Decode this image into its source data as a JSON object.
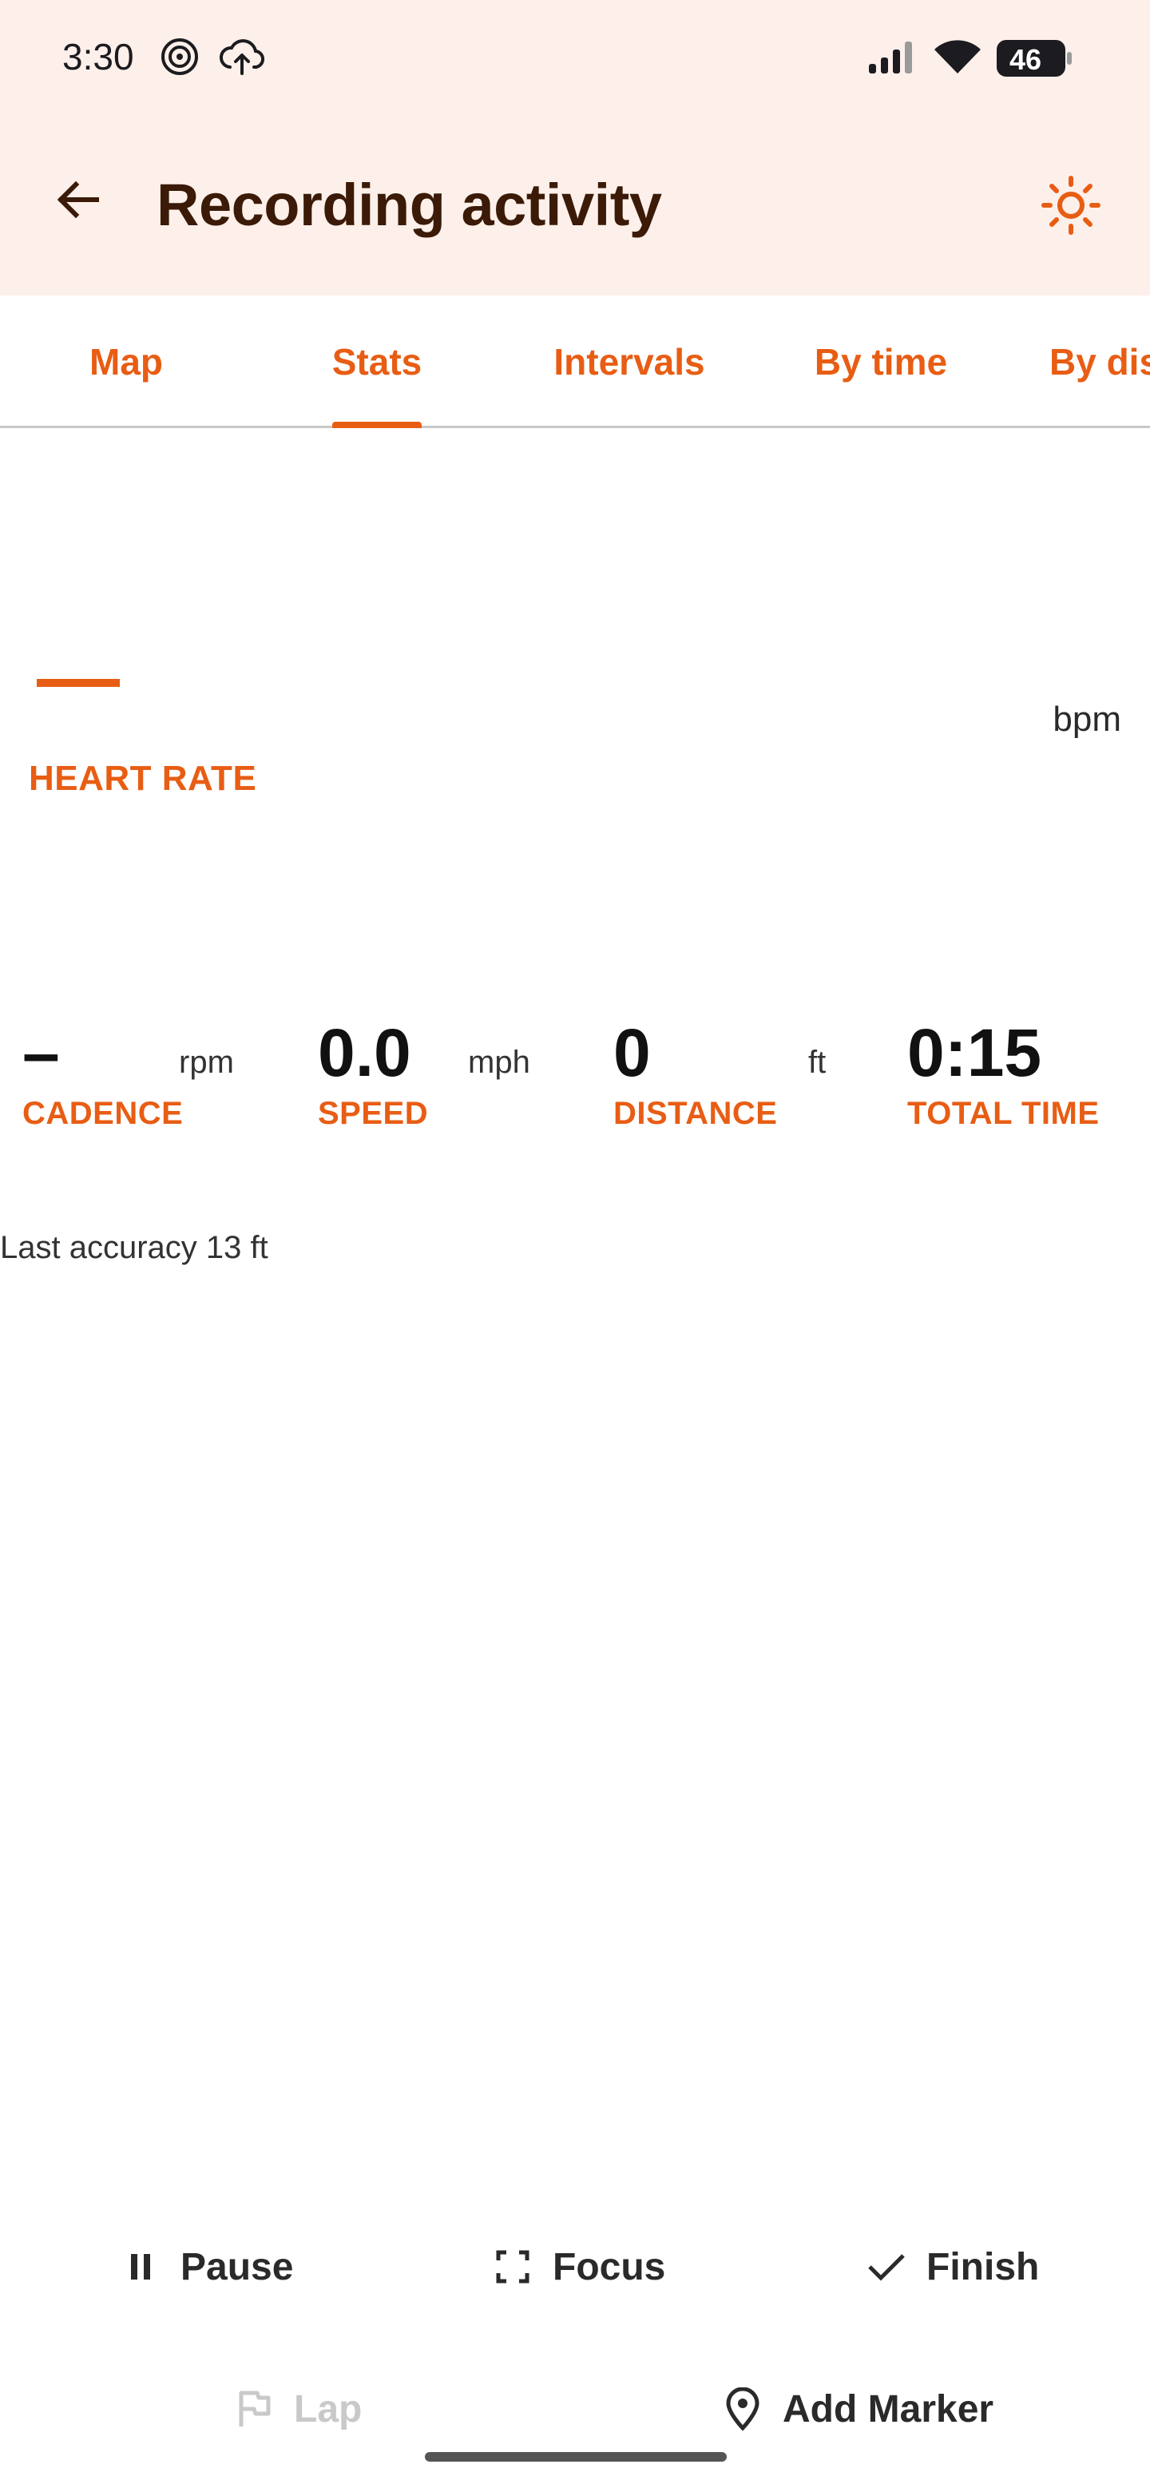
{
  "status_bar": {
    "time": "3:30",
    "battery": "46"
  },
  "app_bar": {
    "title": "Recording activity"
  },
  "tabs": [
    {
      "label": "Map"
    },
    {
      "label": "Stats"
    },
    {
      "label": "Intervals"
    },
    {
      "label": "By time"
    },
    {
      "label": "By dis"
    }
  ],
  "heart_rate": {
    "value": "—",
    "unit": "bpm",
    "label": "HEART RATE"
  },
  "stats": [
    {
      "value": "–",
      "unit": "rpm",
      "label": "CADENCE"
    },
    {
      "value": "0.0",
      "unit": "mph",
      "label": "SPEED"
    },
    {
      "value": "0",
      "unit": "ft",
      "label": "DISTANCE"
    },
    {
      "value": "0:15",
      "unit": "",
      "label": "TOTAL TIME"
    }
  ],
  "accuracy": "Last accuracy 13 ft",
  "actions": {
    "pause": "Pause",
    "focus": "Focus",
    "finish": "Finish",
    "lap": "Lap",
    "add_marker": "Add Marker"
  },
  "colors": {
    "accent": "#e85d14",
    "topbar_bg": "#fdf0ea",
    "title": "#3b1a08"
  },
  "icons": [
    "arrow-back-icon",
    "brightness-icon",
    "pause-icon",
    "focus-icon",
    "check-icon",
    "flag-icon",
    "location-pin-icon"
  ]
}
